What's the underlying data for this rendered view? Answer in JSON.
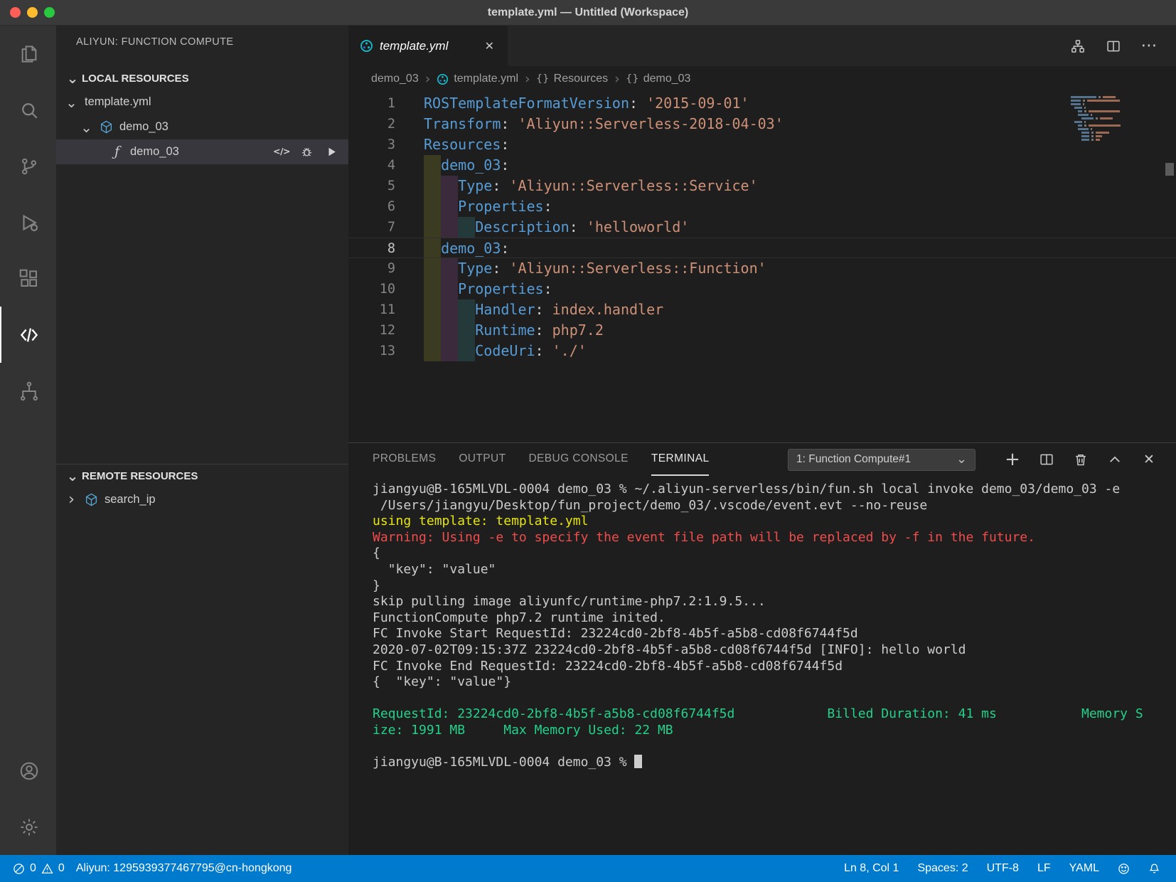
{
  "window": {
    "title": "template.yml — Untitled (Workspace)"
  },
  "colors": {
    "status_bar": "#007acc",
    "selection_bg": "#37373d",
    "yaml_key": "#569cd6",
    "yaml_string": "#ce9178",
    "terminal_yellow": "#e5e510",
    "terminal_red": "#f14c4c",
    "terminal_green": "#23d18b",
    "mac_close": "#ff5f57",
    "mac_min": "#febc2e",
    "mac_zoom": "#28c840",
    "accent_teal": "#18b8c8"
  },
  "glyphs": {
    "chevron_down": "⌄",
    "chevron_right": "›",
    "close": "✕",
    "more": "⋯",
    "plus": "+",
    "braces": "{}",
    "code_tag": "</>",
    "function": "ƒ",
    "breadcrumb_sep": "›"
  },
  "activity_bar": {
    "top": [
      {
        "name": "explorer",
        "icon": "svg:files"
      },
      {
        "name": "search",
        "icon": "svg:search"
      },
      {
        "name": "source-control",
        "icon": "svg:scm"
      },
      {
        "name": "run-debug",
        "icon": "svg:debug"
      },
      {
        "name": "extensions",
        "icon": "svg:extensions"
      },
      {
        "name": "aliyun-serverless",
        "icon": "svg:serverless",
        "active": true
      },
      {
        "name": "api-connector",
        "icon": "svg:connector"
      }
    ],
    "bottom": [
      {
        "name": "accounts",
        "icon": "svg:account"
      },
      {
        "name": "settings",
        "icon": "svg:gear"
      }
    ]
  },
  "sidebar": {
    "title": "ALIYUN: FUNCTION COMPUTE",
    "local": {
      "header": "LOCAL RESOURCES",
      "items": [
        {
          "label": "template.yml",
          "level": 0,
          "chevron": "down"
        },
        {
          "label": "demo_03",
          "level": 1,
          "chevron": "down",
          "icon": "svg:cube"
        },
        {
          "label": "demo_03",
          "level": 2,
          "icon": "glyph:function",
          "selected": true,
          "actions": [
            {
              "name": "open-code",
              "icon": "glyph:code_tag"
            },
            {
              "name": "local-debug",
              "icon": "svg:bug"
            },
            {
              "name": "local-invoke",
              "icon": "svg:play"
            }
          ]
        }
      ]
    },
    "remote": {
      "header": "REMOTE RESOURCES",
      "items": [
        {
          "label": "search_ip",
          "level": 0,
          "chevron": "right",
          "icon": "svg:cube"
        }
      ]
    }
  },
  "editor": {
    "tab": {
      "label": "template.yml",
      "icon": "svg:aliyun"
    },
    "actions": [
      {
        "name": "deploy",
        "icon": "svg:deploy"
      },
      {
        "name": "split-editor",
        "icon": "svg:split"
      },
      {
        "name": "more-actions",
        "icon": "glyph:more"
      }
    ],
    "breadcrumbs": [
      {
        "label": "demo_03"
      },
      {
        "label": "template.yml",
        "icon": "svg:aliyun"
      },
      {
        "label": "Resources",
        "icon": "glyph:braces"
      },
      {
        "label": "demo_03",
        "icon": "glyph:braces"
      }
    ],
    "active_line": 8,
    "lines": [
      {
        "num": 1,
        "indent": 0,
        "tokens": [
          {
            "c": "key",
            "t": "ROSTemplateFormatVersion"
          },
          {
            "c": "punc",
            "t": ": "
          },
          {
            "c": "str",
            "t": "'2015-09-01'"
          }
        ]
      },
      {
        "num": 2,
        "indent": 0,
        "tokens": [
          {
            "c": "key",
            "t": "Transform"
          },
          {
            "c": "punc",
            "t": ": "
          },
          {
            "c": "str",
            "t": "'Aliyun::Serverless-2018-04-03'"
          }
        ]
      },
      {
        "num": 3,
        "indent": 0,
        "tokens": [
          {
            "c": "key",
            "t": "Resources"
          },
          {
            "c": "punc",
            "t": ":"
          }
        ]
      },
      {
        "num": 4,
        "indent": 1,
        "tokens": [
          {
            "c": "key",
            "t": "demo_03"
          },
          {
            "c": "punc",
            "t": ":"
          }
        ]
      },
      {
        "num": 5,
        "indent": 2,
        "tokens": [
          {
            "c": "key",
            "t": "Type"
          },
          {
            "c": "punc",
            "t": ": "
          },
          {
            "c": "str",
            "t": "'Aliyun::Serverless::Service'"
          }
        ]
      },
      {
        "num": 6,
        "indent": 2,
        "tokens": [
          {
            "c": "key",
            "t": "Properties"
          },
          {
            "c": "punc",
            "t": ":"
          }
        ]
      },
      {
        "num": 7,
        "indent": 3,
        "tokens": [
          {
            "c": "key",
            "t": "Description"
          },
          {
            "c": "punc",
            "t": ": "
          },
          {
            "c": "str",
            "t": "'helloworld'"
          }
        ]
      },
      {
        "num": 8,
        "indent": 1,
        "tokens": [
          {
            "c": "key",
            "t": "demo_03"
          },
          {
            "c": "punc",
            "t": ":"
          }
        ]
      },
      {
        "num": 9,
        "indent": 2,
        "tokens": [
          {
            "c": "key",
            "t": "Type"
          },
          {
            "c": "punc",
            "t": ": "
          },
          {
            "c": "str",
            "t": "'Aliyun::Serverless::Function'"
          }
        ]
      },
      {
        "num": 10,
        "indent": 2,
        "tokens": [
          {
            "c": "key",
            "t": "Properties"
          },
          {
            "c": "punc",
            "t": ":"
          }
        ]
      },
      {
        "num": 11,
        "indent": 3,
        "tokens": [
          {
            "c": "key",
            "t": "Handler"
          },
          {
            "c": "punc",
            "t": ": "
          },
          {
            "c": "val",
            "t": "index.handler"
          }
        ]
      },
      {
        "num": 12,
        "indent": 3,
        "tokens": [
          {
            "c": "key",
            "t": "Runtime"
          },
          {
            "c": "punc",
            "t": ": "
          },
          {
            "c": "val",
            "t": "php7.2"
          }
        ]
      },
      {
        "num": 13,
        "indent": 3,
        "tokens": [
          {
            "c": "key",
            "t": "CodeUri"
          },
          {
            "c": "punc",
            "t": ": "
          },
          {
            "c": "str",
            "t": "'./'"
          }
        ]
      }
    ]
  },
  "panel": {
    "tabs": [
      {
        "name": "problems",
        "label": "PROBLEMS"
      },
      {
        "name": "output",
        "label": "OUTPUT"
      },
      {
        "name": "debug-console",
        "label": "DEBUG CONSOLE"
      },
      {
        "name": "terminal",
        "label": "TERMINAL",
        "active": true
      }
    ],
    "dropdown": {
      "value": "1: Function Compute#1"
    },
    "actions": [
      {
        "name": "new-terminal",
        "icon": "glyph:plus"
      },
      {
        "name": "split-terminal",
        "icon": "svg:split"
      },
      {
        "name": "kill-terminal",
        "icon": "svg:trash"
      },
      {
        "name": "maximize-panel",
        "icon": "svg:chevup"
      },
      {
        "name": "close-panel",
        "icon": "glyph:close"
      }
    ],
    "terminal": [
      {
        "c": "fg",
        "t": "jiangyu@B-165MLVDL-0004 demo_03 % ~/.aliyun-serverless/bin/fun.sh local invoke demo_03/demo_03 -e"
      },
      {
        "c": "fg",
        "t": " /Users/jiangyu/Desktop/fun_project/demo_03/.vscode/event.evt --no-reuse"
      },
      {
        "c": "yellow",
        "t": "using template: template.yml"
      },
      {
        "c": "red",
        "t": "Warning: Using -e to specify the event file path will be replaced by -f in the future."
      },
      {
        "c": "fg",
        "t": "{"
      },
      {
        "c": "fg",
        "t": "  \"key\": \"value\""
      },
      {
        "c": "fg",
        "t": "}"
      },
      {
        "c": "fg",
        "t": "skip pulling image aliyunfc/runtime-php7.2:1.9.5..."
      },
      {
        "c": "fg",
        "t": "FunctionCompute php7.2 runtime inited."
      },
      {
        "c": "fg",
        "t": "FC Invoke Start RequestId: 23224cd0-2bf8-4b5f-a5b8-cd08f6744f5d"
      },
      {
        "c": "fg",
        "t": "2020-07-02T09:15:37Z 23224cd0-2bf8-4b5f-a5b8-cd08f6744f5d [INFO]: hello world"
      },
      {
        "c": "fg",
        "t": "FC Invoke End RequestId: 23224cd0-2bf8-4b5f-a5b8-cd08f6744f5d"
      },
      {
        "c": "fg",
        "t": "{  \"key\": \"value\"}"
      },
      {
        "c": "fg",
        "t": ""
      },
      {
        "c": "green",
        "t": "RequestId: 23224cd0-2bf8-4b5f-a5b8-cd08f6744f5d            Billed Duration: 41 ms           Memory S"
      },
      {
        "c": "green",
        "t": "ize: 1991 MB     Max Memory Used: 22 MB"
      },
      {
        "c": "fg",
        "t": ""
      },
      {
        "c": "fg",
        "t": "jiangyu@B-165MLVDL-0004 demo_03 % ",
        "cursor": true
      }
    ]
  },
  "status_bar": {
    "errors": "0",
    "warnings": "0",
    "account": "Aliyun: 1295939377467795@cn-hongkong",
    "right": [
      {
        "name": "line-col-indicator",
        "label": "Ln 8, Col 1"
      },
      {
        "name": "indent-indicator",
        "label": "Spaces: 2"
      },
      {
        "name": "encoding-indicator",
        "label": "UTF-8"
      },
      {
        "name": "eol-indicator",
        "label": "LF"
      },
      {
        "name": "language-indicator",
        "label": "YAML"
      }
    ],
    "icons": [
      {
        "name": "feedback",
        "icon": "svg:smiley"
      },
      {
        "name": "notifications",
        "icon": "svg:bell"
      }
    ]
  }
}
